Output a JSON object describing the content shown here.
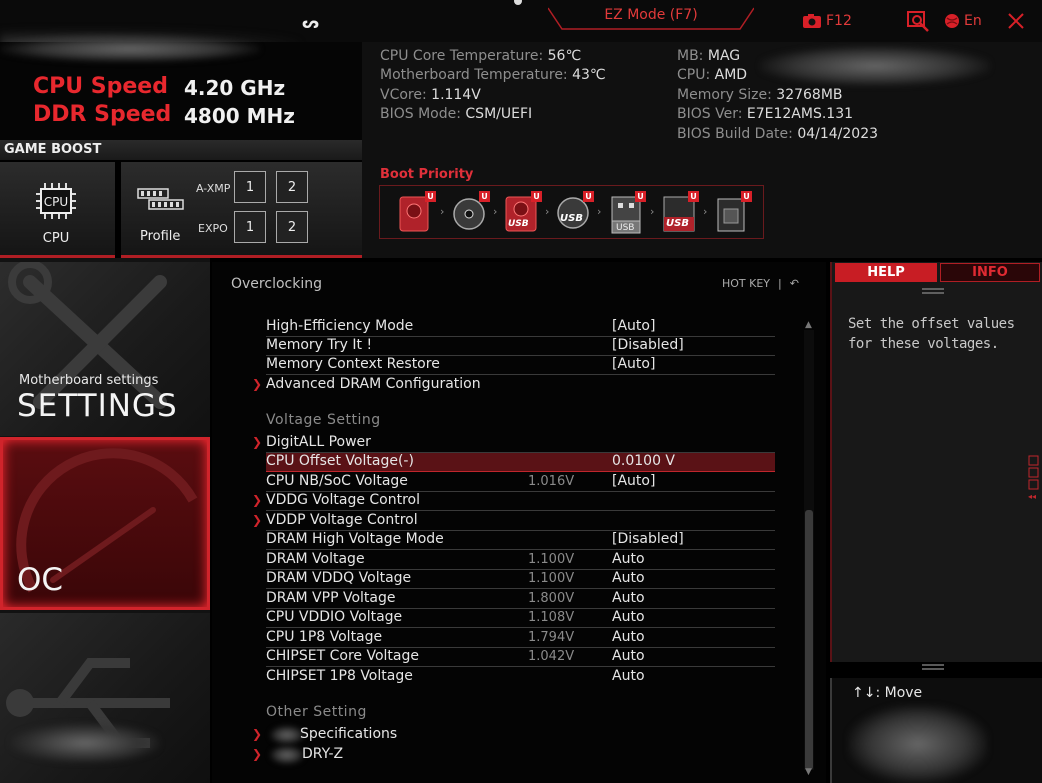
{
  "header": {
    "ez_mode": "EZ Mode (F7)",
    "screenshot_key": "F12",
    "language": "En"
  },
  "speed": {
    "cpu_label": "CPU Speed",
    "cpu_value": "4.20 GHz",
    "ddr_label": "DDR Speed",
    "ddr_value": "4800 MHz"
  },
  "game_boost": {
    "label": "GAME BOOST",
    "cpu_tile": "CPU",
    "cpu_chip_text": "CPU",
    "profile_tile": "Profile",
    "axmp_label": "A-XMP",
    "expo_label": "EXPO",
    "axmp_buttons": [
      "1",
      "2"
    ],
    "expo_buttons": [
      "1",
      "2"
    ]
  },
  "system_info": {
    "cpu_core_temp_label": "CPU Core Temperature: ",
    "cpu_core_temp": "56℃",
    "mb_temp_label": "Motherboard Temperature: ",
    "mb_temp": "43℃",
    "vcore_label": "VCore: ",
    "vcore": "1.114V",
    "bios_mode_label": "BIOS Mode: ",
    "bios_mode": "CSM/UEFI",
    "mb_label": "MB: ",
    "mb": "MAG",
    "cpu_label": "CPU: ",
    "cpu": "AMD",
    "memory_size_label": "Memory Size: ",
    "memory_size": "32768MB",
    "bios_ver_label": "BIOS Ver: ",
    "bios_ver": "E7E12AMS.131",
    "bios_date_label": "BIOS Build Date: ",
    "bios_date": "04/14/2023"
  },
  "boot": {
    "title": "Boot Priority",
    "badge": "U",
    "devices": [
      "hdd-icon",
      "optical-disc-icon",
      "usb-drive-icon",
      "usb-disc-icon",
      "usb-device-icon",
      "usb-floppy-icon",
      "network-card-icon"
    ],
    "usb_text": "USB"
  },
  "nav": {
    "settings_sub": "Motherboard settings",
    "settings_title": "SETTINGS",
    "oc_title": "OC"
  },
  "main": {
    "title": "Overclocking",
    "hotkey": "HOT KEY",
    "hotkey_sep": "|",
    "rows_top": [
      {
        "name": "High-Efficiency Mode",
        "value": "[Auto]"
      },
      {
        "name": "Memory Try It !",
        "value": "[Disabled]"
      },
      {
        "name": "Memory Context Restore",
        "value": "[Auto]"
      },
      {
        "name": "Advanced DRAM Configuration",
        "value": ""
      }
    ],
    "voltage_section": "Voltage Setting",
    "rows_voltage": [
      {
        "name": "DigitALL Power",
        "cur": "",
        "value": ""
      },
      {
        "name": "CPU Offset Voltage(-)",
        "cur": "",
        "value": "0.0100 V"
      },
      {
        "name": "CPU NB/SoC Voltage",
        "cur": "1.016V",
        "value": "[Auto]"
      },
      {
        "name": "VDDG Voltage Control",
        "cur": "",
        "value": ""
      },
      {
        "name": "VDDP Voltage Control",
        "cur": "",
        "value": ""
      },
      {
        "name": "DRAM High Voltage Mode",
        "cur": "",
        "value": "[Disabled]"
      },
      {
        "name": "DRAM Voltage",
        "cur": "1.100V",
        "value": "Auto"
      },
      {
        "name": "DRAM VDDQ Voltage",
        "cur": "1.100V",
        "value": "Auto"
      },
      {
        "name": "DRAM VPP Voltage",
        "cur": "1.800V",
        "value": "Auto"
      },
      {
        "name": "CPU VDDIO Voltage",
        "cur": "1.108V",
        "value": "Auto"
      },
      {
        "name": "CPU 1P8 Voltage",
        "cur": "1.794V",
        "value": "Auto"
      },
      {
        "name": "CHIPSET Core Voltage",
        "cur": "1.042V",
        "value": "Auto"
      },
      {
        "name": "CHIPSET 1P8 Voltage",
        "cur": "",
        "value": "Auto"
      }
    ],
    "other_section": "Other  Setting",
    "rows_other": [
      {
        "name": "Specifications"
      },
      {
        "name": "DRY-Z"
      }
    ]
  },
  "help": {
    "help_tab": "HELP",
    "info_tab": "INFO",
    "text": "Set the offset values for these voltages.",
    "move_key": "↑↓: Move"
  }
}
